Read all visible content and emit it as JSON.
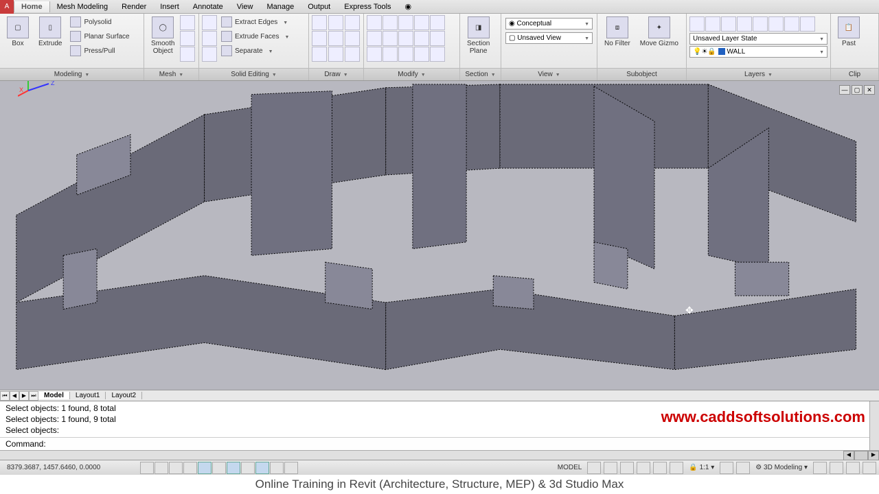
{
  "tabs": [
    "Home",
    "Mesh Modeling",
    "Render",
    "Insert",
    "Annotate",
    "View",
    "Manage",
    "Output",
    "Express Tools"
  ],
  "activeTab": "Home",
  "ribbon": {
    "modeling": {
      "title": "Modeling",
      "box": "Box",
      "extrude": "Extrude",
      "polysolid": "Polysolid",
      "planar": "Planar Surface",
      "presspull": "Press/Pull"
    },
    "mesh": {
      "title": "Mesh",
      "smooth": "Smooth\nObject"
    },
    "solidEditing": {
      "title": "Solid Editing",
      "extractEdges": "Extract Edges",
      "extrudeFaces": "Extrude Faces",
      "separate": "Separate"
    },
    "draw": {
      "title": "Draw"
    },
    "modify": {
      "title": "Modify"
    },
    "section": {
      "title": "Section",
      "plane": "Section\nPlane"
    },
    "view": {
      "title": "View",
      "visualStyle": "Conceptual",
      "savedView": "Unsaved View"
    },
    "subobject": {
      "title": "Subobject",
      "filter": "No Filter",
      "gizmo": "Move Gizmo"
    },
    "layers": {
      "title": "Layers",
      "state": "Unsaved Layer State",
      "current": "WALL"
    },
    "clipboard": {
      "title": "Clip",
      "paste": "Past"
    }
  },
  "layoutTabs": [
    "Model",
    "Layout1",
    "Layout2"
  ],
  "activeLayout": "Model",
  "cmd": {
    "line1": "Select objects: 1 found, 8 total",
    "line2": "Select objects: 1 found, 9 total",
    "line3": "Select objects:",
    "prompt": "Command:"
  },
  "watermark": "www.caddsoftsolutions.com",
  "status": {
    "coords": "8379.3687, 1457.6460, 0.0000",
    "space": "MODEL",
    "scale": "1:1",
    "workspace": "3D Modeling"
  },
  "footer": "Online Training in Revit (Architecture, Structure, MEP) & 3d Studio Max"
}
